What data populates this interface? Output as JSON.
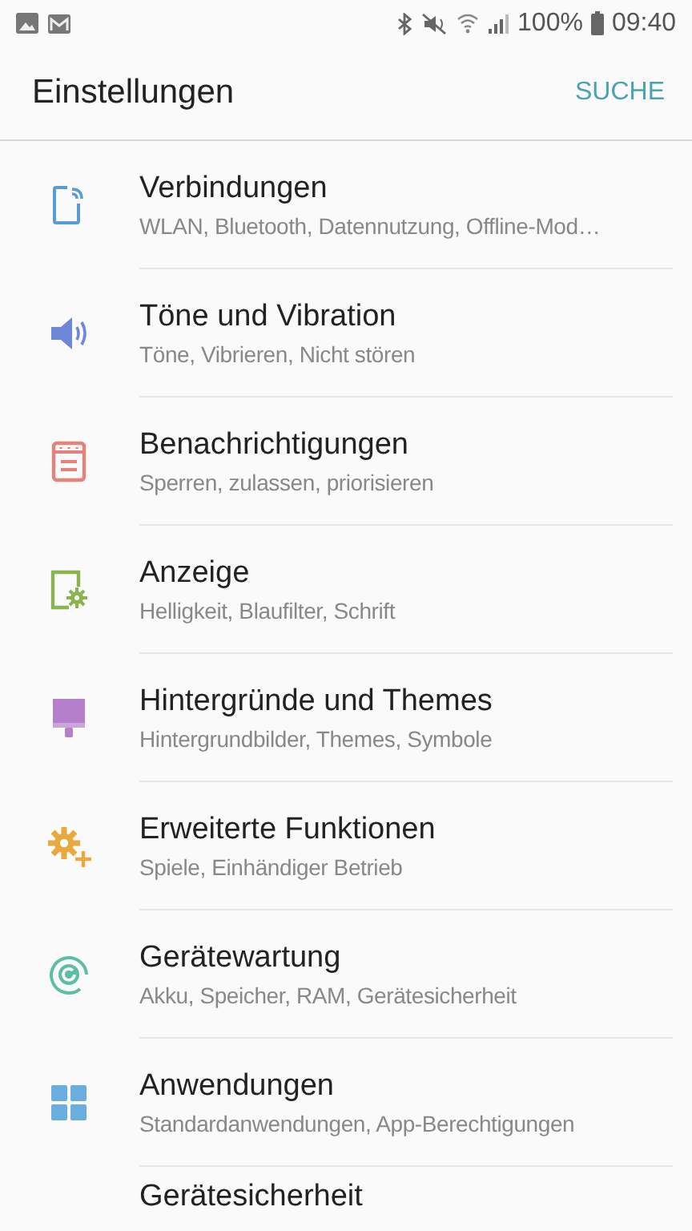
{
  "status_bar": {
    "battery": "100%",
    "time": "09:40"
  },
  "header": {
    "title": "Einstellungen",
    "action": "SUCHE"
  },
  "items": [
    {
      "kind": "connections",
      "color": "#5b9bd5",
      "title": "Verbindungen",
      "subtitle": "WLAN, Bluetooth, Datennutzung, Offline-Mod…"
    },
    {
      "kind": "sound",
      "color": "#6d87d9",
      "title": "Töne und Vibration",
      "subtitle": "Töne, Vibrieren, Nicht stören"
    },
    {
      "kind": "notifications",
      "color": "#e5837a",
      "title": "Benachrichtigungen",
      "subtitle": "Sperren, zulassen, priorisieren"
    },
    {
      "kind": "display",
      "color": "#8bb34e",
      "title": "Anzeige",
      "subtitle": "Helligkeit, Blaufilter, Schrift"
    },
    {
      "kind": "themes",
      "color": "#b57fcc",
      "title": "Hintergründe und Themes",
      "subtitle": "Hintergrundbilder, Themes, Symbole"
    },
    {
      "kind": "advanced",
      "color": "#e9a93c",
      "title": "Erweiterte Funktionen",
      "subtitle": "Spiele, Einhändiger Betrieb"
    },
    {
      "kind": "maintenance",
      "color": "#5cbfa5",
      "title": "Gerätewartung",
      "subtitle": "Akku, Speicher, RAM, Gerätesicherheit"
    },
    {
      "kind": "apps",
      "color": "#6aaee0",
      "title": "Anwendungen",
      "subtitle": "Standardanwendungen, App-Berechtigungen"
    },
    {
      "kind": "security",
      "title": "Gerätesicherheit"
    }
  ]
}
